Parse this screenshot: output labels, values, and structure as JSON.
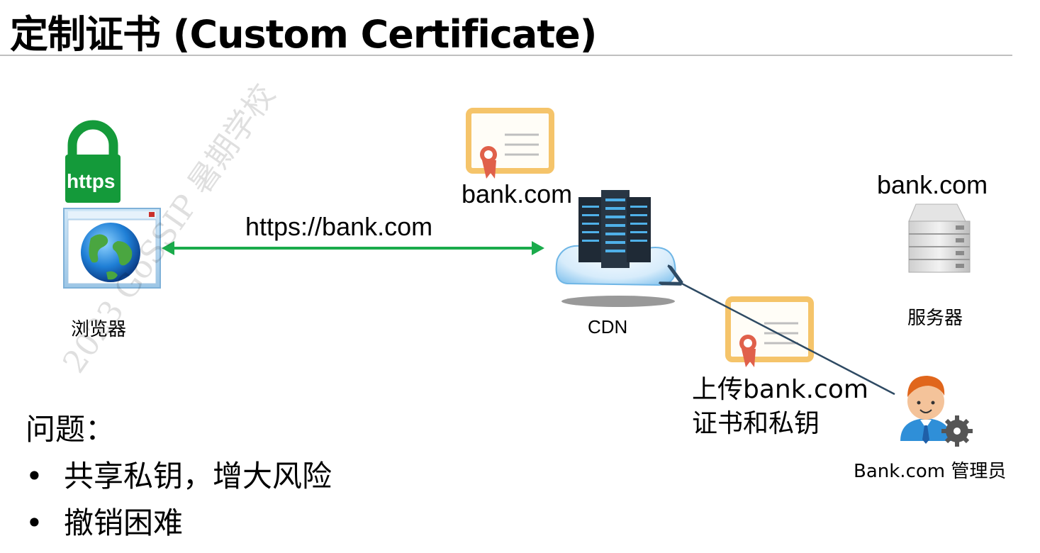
{
  "title": "定制证书 (Custom Certificate)",
  "diagram": {
    "browser_badge": "https",
    "browser_label": "浏览器",
    "link_label": "https://bank.com",
    "cdn_cert_label": "bank.com",
    "cdn_label": "CDN",
    "server_domain": "bank.com",
    "server_label": "服务器",
    "upload_line1": "上传bank.com",
    "upload_line2": "证书和私钥",
    "admin_label": "Bank.com 管理员"
  },
  "problems": {
    "title": "问题：",
    "items": [
      "共享私钥，增大风险",
      "撤销困难"
    ]
  },
  "watermark": "2023 GoSSIP 暑期学校",
  "colors": {
    "arrow_green": "#1aab4b",
    "lock_green": "#149a3a",
    "cert_border": "#f5c46a",
    "seal_red": "#e0604a",
    "admin_arrow": "#2e4a63"
  }
}
